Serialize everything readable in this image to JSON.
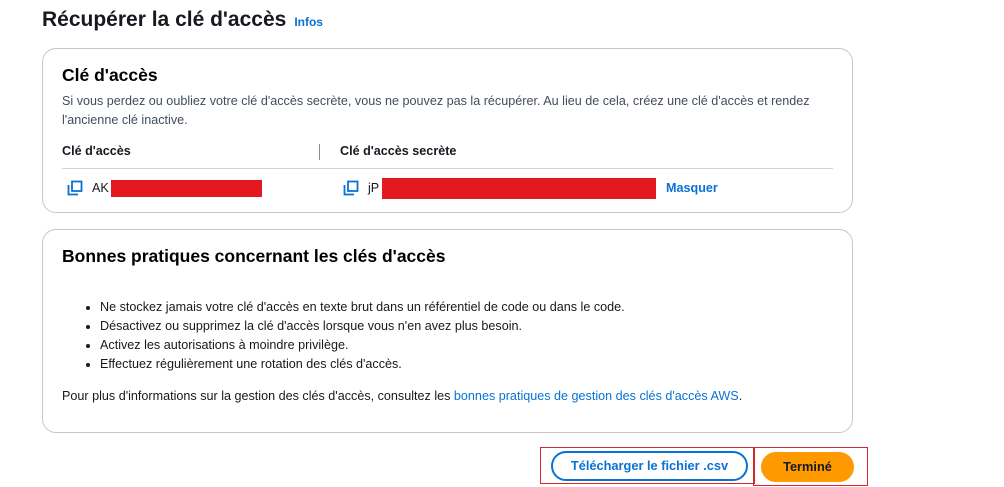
{
  "header": {
    "title": "Récupérer la clé d'accès",
    "info_link": "Infos"
  },
  "access_key_card": {
    "title": "Clé d'accès",
    "description": "Si vous perdez ou oubliez votre clé d'accès secrète, vous ne pouvez pas la récupérer. Au lieu de cela, créez une clé d'accès et rendez l'ancienne clé inactive.",
    "columns": [
      "Clé d'accès",
      "Clé d'accès secrète"
    ],
    "access_key_visible": "AK",
    "secret_key_visible": "jP",
    "hide_label": "Masquer",
    "icons": [
      "copy-icon",
      "copy-icon"
    ]
  },
  "best_practices_card": {
    "title": "Bonnes pratiques concernant les clés d'accès",
    "items": [
      "Ne stockez jamais votre clé d'accès en texte brut dans un référentiel de code ou dans le code.",
      "Désactivez ou supprimez la clé d'accès lorsque vous n'en avez plus besoin.",
      "Activez les autorisations à moindre privilège.",
      "Effectuez régulièrement une rotation des clés d'accès."
    ],
    "more_info_prefix": "Pour plus d'informations sur la gestion des clés d'accès, consultez les ",
    "more_info_link": "bonnes pratiques de gestion des clés d'accès AWS",
    "more_info_suffix": "."
  },
  "actions": {
    "download_label": "Télécharger le fichier .csv",
    "done_label": "Terminé"
  },
  "colors": {
    "link": "#0972d3",
    "primary_button": "#ff9900",
    "redaction": "#e3191f",
    "highlight_border": "#d9262c"
  }
}
